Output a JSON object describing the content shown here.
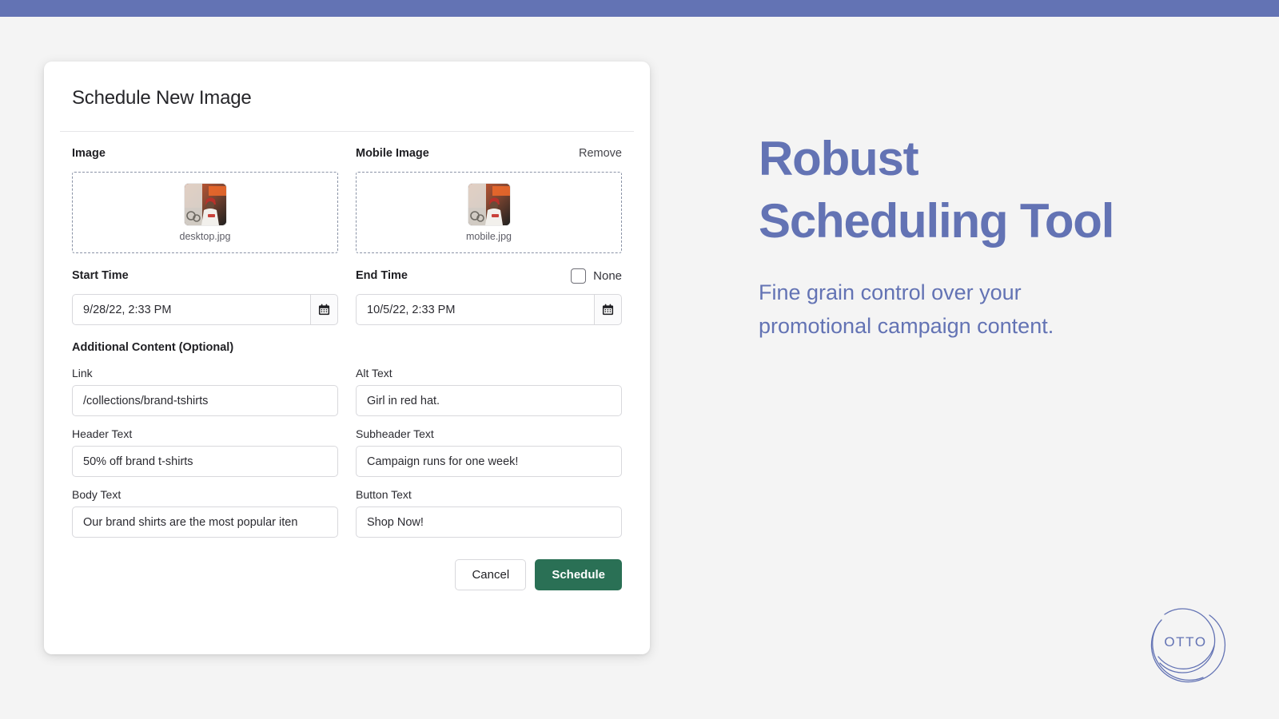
{
  "theme": {
    "accent": "#6373b4",
    "page_bg": "#f4f4f4",
    "card_bg": "#ffffff",
    "primary_button_bg": "#2a7055",
    "dropzone_border": "#8a93a6"
  },
  "dialog": {
    "title": "Schedule New Image",
    "image_field": {
      "label": "Image",
      "dropzone_filename": "desktop.jpg",
      "thumbnail_icon": "photo-thumbnail"
    },
    "mobile_image_field": {
      "label": "Mobile Image",
      "remove_label": "Remove",
      "dropzone_filename": "mobile.jpg",
      "thumbnail_icon": "photo-thumbnail"
    },
    "start_time": {
      "label": "Start Time",
      "value": "9/28/22, 2:33 PM",
      "calendar_icon": "calendar-icon"
    },
    "end_time": {
      "label": "End Time",
      "value": "10/5/22, 2:33 PM",
      "calendar_icon": "calendar-icon",
      "none_checkbox_label": "None",
      "none_checked": false
    },
    "additional_content": {
      "section_title": "Additional Content (Optional)",
      "fields": [
        {
          "label": "Link",
          "value": "/collections/brand-tshirts"
        },
        {
          "label": "Alt Text",
          "value": "Girl in red hat."
        },
        {
          "label": "Header Text",
          "value": "50% off brand t-shirts"
        },
        {
          "label": "Subheader Text",
          "value": "Campaign runs for one week!"
        },
        {
          "label": "Body Text",
          "value": "Our brand shirts are the most popular iten"
        },
        {
          "label": "Button Text",
          "value": "Shop Now!"
        }
      ]
    },
    "footer": {
      "cancel_label": "Cancel",
      "schedule_label": "Schedule"
    }
  },
  "promo": {
    "title": "Robust\nScheduling Tool",
    "subtitle": "Fine grain control over your\npromotional campaign content."
  },
  "logo": {
    "text": "OTTO"
  }
}
